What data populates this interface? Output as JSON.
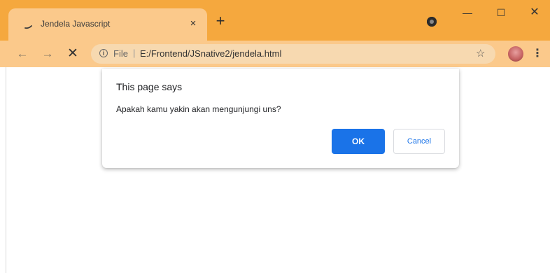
{
  "browser": {
    "tab": {
      "title": "Jendela Javascript",
      "close_glyph": "×",
      "favicon": "loading-spinner-icon"
    },
    "new_tab_glyph": "+",
    "window_controls": {
      "minimize_glyph": "—",
      "maximize_glyph": "☐",
      "close_glyph": "✕"
    },
    "theme_color": "#f5a83e",
    "toolbar_color": "#fbc98b"
  },
  "toolbar": {
    "back_glyph": "←",
    "forward_glyph": "→",
    "stop_glyph": "✕",
    "omnibox": {
      "info_glyph": "i",
      "scheme_label": "File",
      "separator": "|",
      "url": "E:/Frontend/JSnative2/jendela.html"
    },
    "star_glyph": "☆",
    "menu_glyph": "⋮"
  },
  "dialog": {
    "title": "This page says",
    "message": "Apakah kamu yakin akan mengunjungi uns?",
    "ok_label": "OK",
    "cancel_label": "Cancel",
    "accent_color": "#1a73e8"
  }
}
